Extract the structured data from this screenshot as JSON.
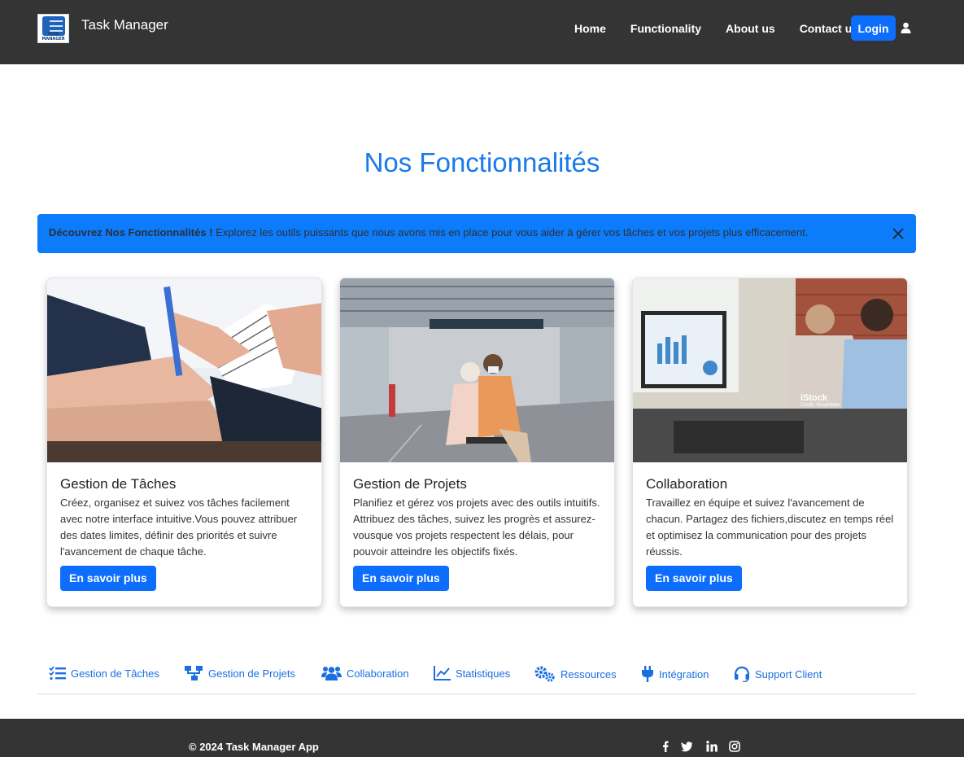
{
  "brand": {
    "logo_caption": "TASK MANAGER",
    "title": "Task Manager"
  },
  "nav": {
    "links": [
      "Home",
      "Functionality",
      "About us",
      "Contact us"
    ],
    "login": "Login"
  },
  "main": {
    "title": "Nos Fonctionnalités",
    "alert": {
      "bold": "Découvrez Nos Fonctionnalités !",
      "text": " Explorez les outils puissants que nous avons mis en place pour vous aider à gérer vos tâches et vos projets plus efficacement."
    },
    "cards": [
      {
        "title": "Gestion de Tâches",
        "text": "Créez, organisez et suivez vos tâches facilement avec notre interface intuitive.Vous pouvez attribuer des dates limites, définir des priorités et suivre l'avancement de chaque tâche.",
        "button": "En savoir plus",
        "image": "handshake-documents-photo"
      },
      {
        "title": "Gestion de Projets",
        "text": "Planifiez et gérez vos projets avec des outils intuitifs. Attribuez des tâches, suivez les progrès et assurez-vousque vos projets respectent les délais, pour pouvoir atteindre les objectifs fixés.",
        "button": "En savoir plus",
        "image": "station-waiting-photo"
      },
      {
        "title": "Collaboration",
        "text": "Travaillez en équipe et suivez l'avancement de chacun. Partagez des fichiers,discutez en temps réel et optimisez la communication pour des projets réussis.",
        "button": "En savoir plus",
        "image": "team-computer-photo",
        "image_watermark": "iStock",
        "image_credit": "Credit: RossHelen"
      }
    ]
  },
  "features": [
    {
      "label": "Gestion de Tâches",
      "icon": "list-check-icon"
    },
    {
      "label": "Gestion de Projets",
      "icon": "sitemap-icon"
    },
    {
      "label": "Collaboration",
      "icon": "users-icon"
    },
    {
      "label": "Statistiques",
      "icon": "line-chart-icon"
    },
    {
      "label": "Ressources",
      "icon": "cogs-icon"
    },
    {
      "label": "Intégration",
      "icon": "plug-icon"
    },
    {
      "label": "Support Client",
      "icon": "headset-icon"
    }
  ],
  "footer": {
    "copyright": "© 2024 Task Manager App",
    "social": [
      "facebook-icon",
      "twitter-icon",
      "linkedin-icon",
      "instagram-icon"
    ]
  },
  "colors": {
    "accent": "#0d6efd",
    "title": "#1a7ae8",
    "dark": "#343434",
    "alert": "#0d7cfb"
  }
}
